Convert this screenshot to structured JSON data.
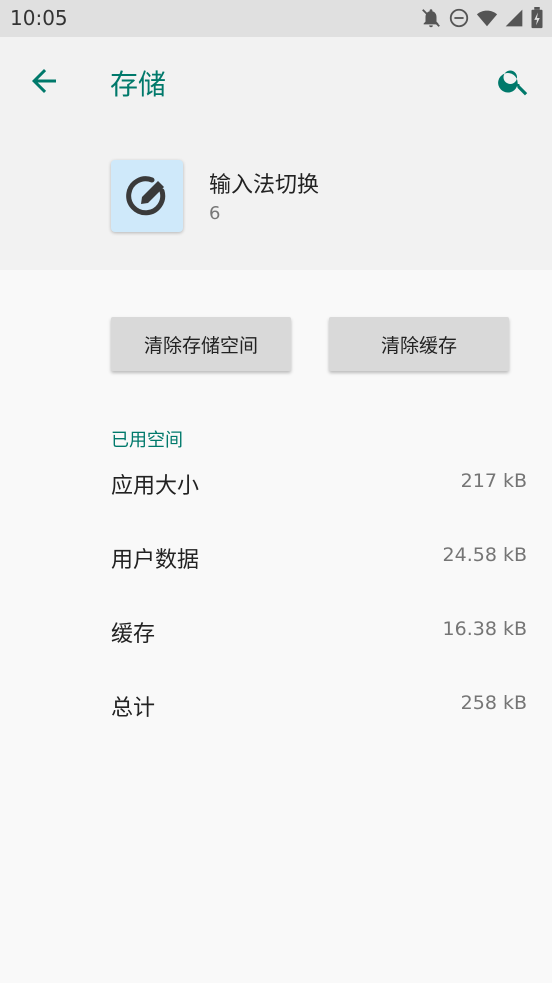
{
  "status_bar": {
    "time": "10:05",
    "icons": [
      "notifications-off-icon",
      "do-not-disturb-icon",
      "wifi-icon",
      "signal-icon",
      "battery-charging-icon"
    ]
  },
  "header": {
    "title": "存储",
    "back_icon": "arrow-back-icon",
    "search_icon": "search-icon"
  },
  "app": {
    "name": "输入法切换",
    "version": "6",
    "icon": "edit-pencil-icon"
  },
  "actions": {
    "clear_storage": "清除存储空间",
    "clear_cache": "清除缓存"
  },
  "storage": {
    "section_label": "已用空间",
    "rows": [
      {
        "label": "应用大小",
        "value": "217 kB"
      },
      {
        "label": "用户数据",
        "value": "24.58 kB"
      },
      {
        "label": "缓存",
        "value": "16.38 kB"
      },
      {
        "label": "总计",
        "value": "258 kB"
      }
    ]
  },
  "colors": {
    "accent": "#00796b",
    "header_bg": "#f2f2f2",
    "app_icon_bg": "#cfe9fa"
  }
}
